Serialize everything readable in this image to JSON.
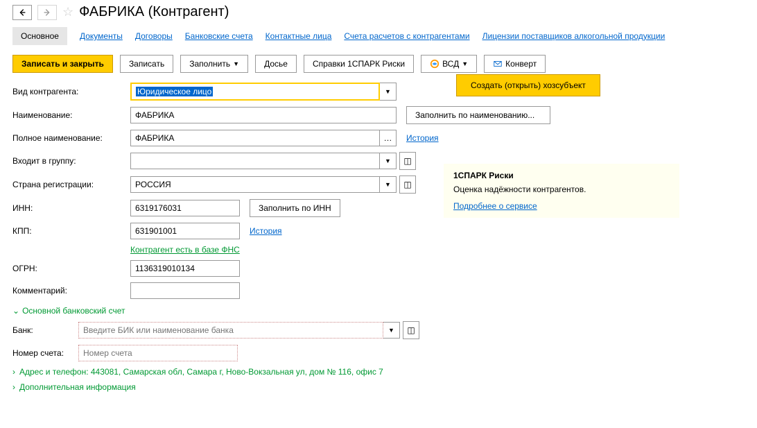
{
  "header": {
    "title": "ФАБРИКА (Контрагент)"
  },
  "tabs": [
    {
      "label": "Основное",
      "active": true
    },
    {
      "label": "Документы"
    },
    {
      "label": "Договоры"
    },
    {
      "label": "Банковские счета"
    },
    {
      "label": "Контактные лица"
    },
    {
      "label": "Счета расчетов с контрагентами"
    },
    {
      "label": "Лицензии поставщиков алкогольной продукции"
    }
  ],
  "toolbar": {
    "save_close": "Записать и закрыть",
    "save": "Записать",
    "fill": "Заполнить",
    "dossier": "Досье",
    "sparks": "Справки 1СПАРК Риски",
    "vsd": "ВСД",
    "envelope": "Конверт",
    "vsd_popup": "Создать (открыть) хозсубъект"
  },
  "form": {
    "type_label": "Вид контрагента:",
    "type_value": "Юридическое лицо",
    "name_label": "Наименование:",
    "name_value": "ФАБРИКА",
    "fill_by_name": "Заполнить по наименованию...",
    "fullname_label": "Полное наименование:",
    "fullname_value": "ФАБРИКА",
    "history": "История",
    "group_label": "Входит в группу:",
    "group_value": "",
    "country_label": "Страна регистрации:",
    "country_value": "РОССИЯ",
    "inn_label": "ИНН:",
    "inn_value": "6319176031",
    "fill_by_inn": "Заполнить по ИНН",
    "kpp_label": "КПП:",
    "kpp_value": "631901001",
    "fns_link": "Контрагент есть в базе ФНС",
    "ogrn_label": "ОГРН:",
    "ogrn_value": "1136319010134",
    "comment_label": "Комментарий:",
    "comment_value": ""
  },
  "bank_section": {
    "title": "Основной банковский счет",
    "bank_label": "Банк:",
    "bank_placeholder": "Введите БИК или наименование банка",
    "accnum_label": "Номер счета:",
    "accnum_placeholder": "Номер счета"
  },
  "address_section": {
    "text": "Адрес и телефон: 443081, Самарская обл, Самара г, Ново-Вокзальная ул, дом № 116, офис 7"
  },
  "extra_section": {
    "title": "Дополнительная информация"
  },
  "info_box": {
    "title": "1СПАРК Риски",
    "text": "Оценка надёжности контрагентов.",
    "link": "Подробнее о сервисе"
  }
}
